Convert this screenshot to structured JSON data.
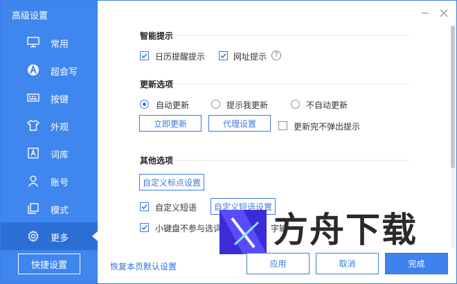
{
  "window": {
    "title": "高级设置"
  },
  "sidebar": {
    "items": [
      {
        "label": "常用",
        "icon": "monitor-icon"
      },
      {
        "label": "超会写",
        "icon": "super-write-icon"
      },
      {
        "label": "按键",
        "icon": "keyboard-icon"
      },
      {
        "label": "外观",
        "icon": "tshirt-icon"
      },
      {
        "label": "词库",
        "icon": "dictionary-icon"
      },
      {
        "label": "账号",
        "icon": "user-icon"
      },
      {
        "label": "模式",
        "icon": "mode-icon"
      },
      {
        "label": "更多",
        "icon": "gear-icon",
        "active": true
      }
    ],
    "quick_setup": "快捷设置"
  },
  "sections": {
    "smart": {
      "title": "智能提示",
      "calendar": {
        "label": "日历提醒提示",
        "checked": true
      },
      "url": {
        "label": "网址提示",
        "checked": true
      },
      "help": "?"
    },
    "update": {
      "title": "更新选项",
      "options": [
        {
          "label": "自动更新",
          "selected": true
        },
        {
          "label": "提示我更新",
          "selected": false
        },
        {
          "label": "不自动更新",
          "selected": false
        }
      ],
      "update_now": "立即更新",
      "proxy": "代理设置",
      "no_popup": {
        "label": "更新完不弹出提示",
        "checked": false
      }
    },
    "other": {
      "title": "其他选项",
      "custom_punct": "自定义标点设置",
      "custom_phrase": {
        "label": "自定义短语",
        "checked": true
      },
      "custom_phrase_btn": "自定义短语设置",
      "mini_kb": {
        "label": "小键盘不参与选词",
        "checked": true,
        "suffix": "字输"
      }
    }
  },
  "footer": {
    "reset": "恢复本页默认设置",
    "apply": "应用",
    "cancel": "取消",
    "done": "完成"
  },
  "watermark": {
    "text": "方舟下载"
  },
  "colors": {
    "sidebar": "#3f86ee",
    "sidebar_active": "#2b6fd6",
    "accent": "#3b7ae0"
  }
}
